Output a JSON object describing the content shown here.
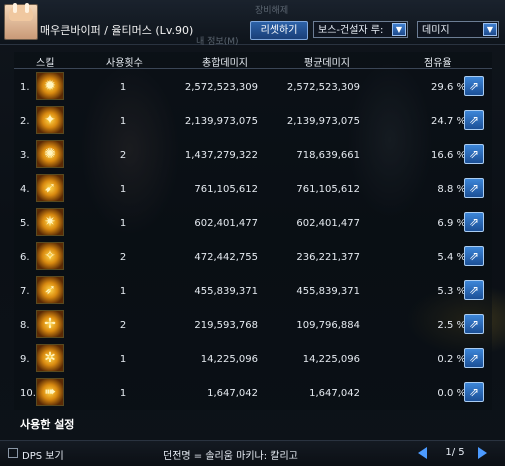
{
  "header": {
    "character": "매우큰바이퍼 / 율티머스 (Lv.90)",
    "reset_label": "리셋하기",
    "target_select": "보스-건설자 루:",
    "metric_select": "데미지",
    "bg_texts": [
      "장비해제",
      "내 정보(M)"
    ]
  },
  "table": {
    "columns": [
      "스킬",
      "사용횟수",
      "총합데미지",
      "평균데미지",
      "점유율"
    ],
    "rows": [
      {
        "rank": "1.",
        "icon": "flame-skill-icon",
        "glyph": "✹",
        "uses": "1",
        "total": "2,572,523,309",
        "avg": "2,572,523,309",
        "share": "29.6 %"
      },
      {
        "rank": "2.",
        "icon": "g0-skill-icon",
        "glyph": "✦",
        "uses": "1",
        "total": "2,139,973,075",
        "avg": "2,139,973,075",
        "share": "24.7 %"
      },
      {
        "rank": "3.",
        "icon": "gear-skill-icon",
        "glyph": "✺",
        "uses": "2",
        "total": "1,437,279,322",
        "avg": "718,639,661",
        "share": "16.6 %"
      },
      {
        "rank": "4.",
        "icon": "cannon-skill-icon",
        "glyph": "➹",
        "uses": "1",
        "total": "761,105,612",
        "avg": "761,105,612",
        "share": "8.8 %"
      },
      {
        "rank": "5.",
        "icon": "burst-skill-icon",
        "glyph": "✷",
        "uses": "1",
        "total": "602,401,477",
        "avg": "602,401,477",
        "share": "6.9 %"
      },
      {
        "rank": "6.",
        "icon": "g1-skill-icon",
        "glyph": "✧",
        "uses": "2",
        "total": "472,442,755",
        "avg": "236,221,377",
        "share": "5.4 %"
      },
      {
        "rank": "7.",
        "icon": "beam-skill-icon",
        "glyph": "➶",
        "uses": "1",
        "total": "455,839,371",
        "avg": "455,839,371",
        "share": "5.3 %"
      },
      {
        "rank": "8.",
        "icon": "g2-skill-icon",
        "glyph": "✢",
        "uses": "2",
        "total": "219,593,768",
        "avg": "109,796,884",
        "share": "2.5 %"
      },
      {
        "rank": "9.",
        "icon": "mech-skill-icon",
        "glyph": "✲",
        "uses": "1",
        "total": "14,225,096",
        "avg": "14,225,096",
        "share": "0.2 %"
      },
      {
        "rank": "10.",
        "icon": "dash-skill-icon",
        "glyph": "➠",
        "uses": "1",
        "total": "1,647,042",
        "avg": "1,647,042",
        "share": "0.0 %"
      }
    ]
  },
  "footer": {
    "used_setting": "사용한 설정",
    "dps_label": "DPS 보기",
    "dungeon": "던전명 = 솔리움 마키나: 칼리고",
    "page": "1/ 5"
  },
  "colors": {
    "accent": "#2d62a8",
    "arrow": "#4c9bff"
  }
}
